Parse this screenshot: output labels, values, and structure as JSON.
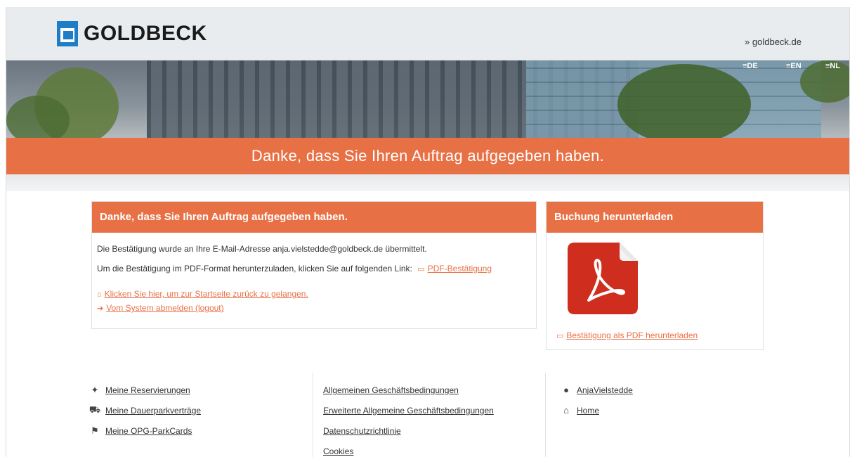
{
  "header": {
    "logo_text": "GOLDBECK",
    "site_link": "» goldbeck.de",
    "languages": [
      "DE",
      "EN",
      "NL"
    ]
  },
  "banner": {
    "title": "Danke, dass Sie Ihren Auftrag aufgegeben haben."
  },
  "confirmation_panel": {
    "title": "Danke, dass Sie Ihren Auftrag aufgegeben haben.",
    "email_text": "Die Bestätigung wurde an Ihre E-Mail-Adresse anja.vielstedde@goldbeck.de übermittelt.",
    "pdf_text": "Um die Bestätigung im PDF-Format herunterzuladen, klicken Sie auf folgenden Link:",
    "pdf_link": "PDF-Bestätigung",
    "home_link": "Klicken Sie hier, um zur Startseite zurück zu gelangen.",
    "logout_link": "Vom System abmelden (logout)"
  },
  "download_panel": {
    "title": "Buchung herunterladen",
    "download_link": "Bestätigung als PDF herunterladen"
  },
  "footer": {
    "col1": [
      "Meine Reservierungen",
      "Meine Dauerparkverträge",
      "Meine OPG-ParkCards"
    ],
    "col2": [
      "Allgemeinen Geschäftsbedingungen",
      "Erweiterte Allgemeine Geschäftsbedingungen",
      "Datenschutzrichtlinie",
      "Cookies"
    ],
    "col3": [
      "AnjaVielstedde",
      "Home"
    ]
  },
  "colors": {
    "accent": "#e87045",
    "logo_blue": "#1d7dc6"
  }
}
